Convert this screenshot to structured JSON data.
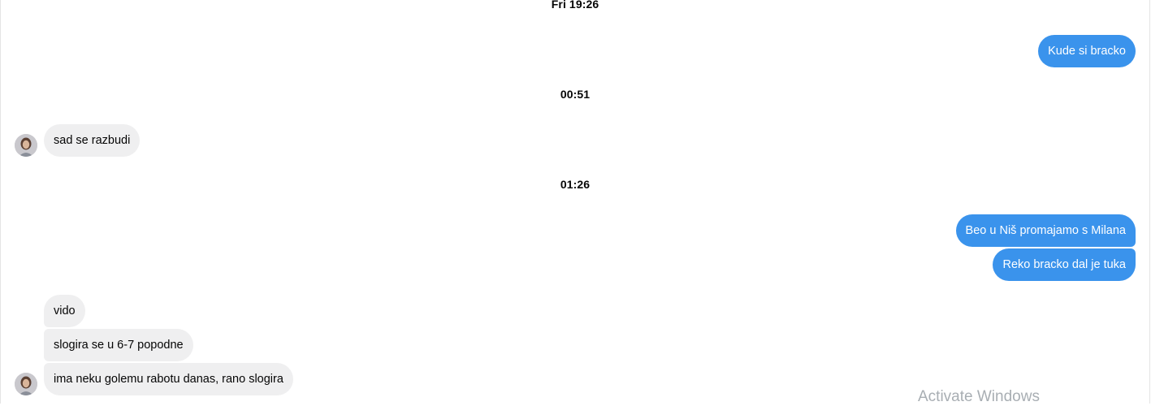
{
  "conversation": {
    "timestamps": [
      "Fri 19:26",
      "00:51",
      "01:26"
    ],
    "messages": {
      "m1": "Kude si bracko",
      "m2": "sad se razbudi",
      "m3": "Beo u Niš promajamo s Milana",
      "m4": "Reko bracko dal je tuka",
      "m5": "vido",
      "m6": "slogira se u 6-7 popodne",
      "m7": "ima neku golemu rabotu danas, rano slogira"
    }
  },
  "colors": {
    "outgoing_bubble": "#3a93ec",
    "incoming_bubble": "#efeff0",
    "text": "#050505"
  },
  "icons": {
    "avatar": "contact-avatar-photo"
  },
  "watermark": {
    "text": "Activate Windows"
  }
}
